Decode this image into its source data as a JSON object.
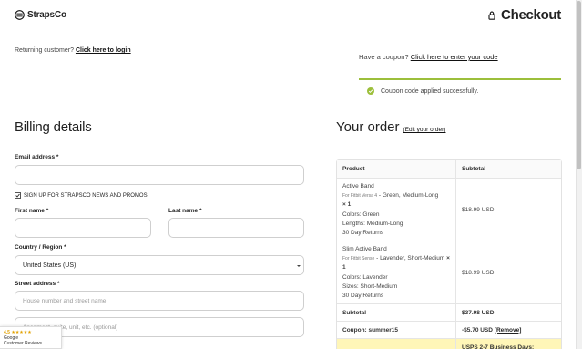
{
  "brand": {
    "name": "StrapsCo"
  },
  "header": {
    "title": "Checkout",
    "icon": "lock-icon"
  },
  "returning": {
    "prompt": "Returning customer?",
    "link": "Click here to login"
  },
  "coupon": {
    "prompt": "Have a coupon?",
    "link": "Click here to enter your code",
    "success": "Coupon code applied successfully.",
    "accent": "#9cbf3b"
  },
  "billing": {
    "title": "Billing details",
    "email_label": "Email address",
    "email_value": "",
    "newsletter_label": "SIGN UP FOR STRAPSCO NEWS AND PROMOS",
    "first_name_label": "First name",
    "last_name_label": "Last name",
    "country_label": "Country / Region",
    "country_value": "United States (US)",
    "street_label": "Street address",
    "street_placeholder": "House number and street name",
    "apt_placeholder": "Apartment, suite, unit, etc. (optional)",
    "required_mark": "*"
  },
  "order": {
    "title": "Your order",
    "edit_link": "(Edit your order)",
    "col_product": "Product",
    "col_subtotal": "Subtotal",
    "items": [
      {
        "name": "Active Band",
        "compat": "For Fitbit Versa 4",
        "variant": " - Green, Medium-Long",
        "qty": "× 1",
        "line1": "Colors: Green",
        "line2": "Lengths: Medium-Long",
        "line3": "30 Day Returns",
        "price": "$18.99 USD"
      },
      {
        "name": "Slim Active Band",
        "compat": "For Fitbit Sense",
        "variant": " - Lavender, Short-Medium",
        "qty": "× 1",
        "line1": "Colors: Lavender",
        "line2": "Sizes: Short-Medium",
        "line3": "30 Day Returns",
        "price": "$18.99 USD"
      }
    ],
    "subtotal_label": "Subtotal",
    "subtotal_value": "$37.98 USD",
    "coupon_label": "Coupon: summer15",
    "coupon_value": "-$5.70 USD",
    "remove_label": "[Remove]",
    "shipping_text": "USPS 2-7 Business Days:",
    "shipping_color": "#fff6b8"
  },
  "reviews": {
    "rating": "4.5 ★★★★★",
    "line1": "Google",
    "line2": "Customer Reviews"
  }
}
